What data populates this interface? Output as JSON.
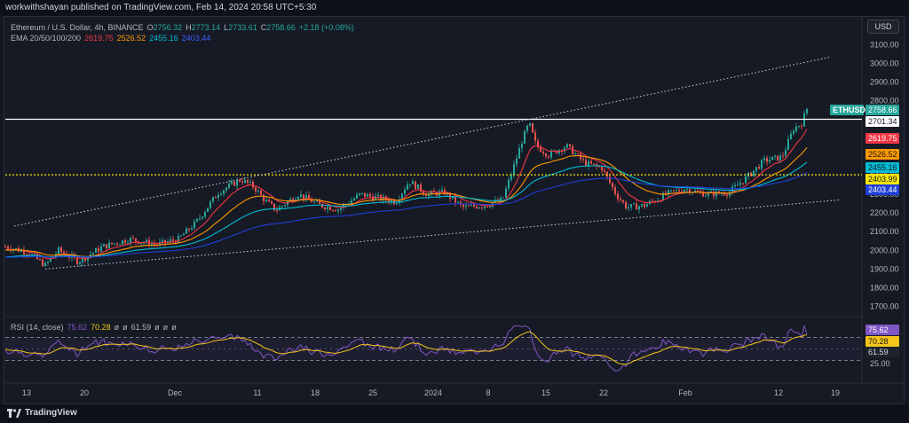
{
  "publisher_line": "workwithshayan published on TradingView.com, Feb 14, 2024 20:58 UTC+5:30",
  "legend": {
    "symbol": "Ethereum / U.S. Dollar, 4h, BINANCE",
    "ohlc": [
      {
        "label": "O",
        "value": "2756.32"
      },
      {
        "label": "H",
        "value": "2773.14"
      },
      {
        "label": "L",
        "value": "2733.61"
      },
      {
        "label": "C",
        "value": "2758.66"
      }
    ],
    "change": "+2.18 (+0.08%)",
    "ema": {
      "label": "EMA 20/50/100/200",
      "values": [
        {
          "value": "2619.75",
          "color": "#f23645"
        },
        {
          "value": "2526.52",
          "color": "#ff9800"
        },
        {
          "value": "2455.16",
          "color": "#00bcd4"
        },
        {
          "value": "2403.44",
          "color": "#1e3fd8"
        }
      ]
    }
  },
  "rsi_legend": {
    "label": "RSI (14, close)",
    "v1": "75.62",
    "v2": "70.28",
    "v3": "61.59",
    "empty": "ø"
  },
  "currency": "USD",
  "price_axis": [
    "3100.00",
    "3000.00",
    "2900.00",
    "2800.00",
    "2700.00",
    "2600.00",
    "2500.00",
    "2400.00",
    "2300.00",
    "2200.00",
    "2100.00",
    "2000.00",
    "1900.00",
    "1800.00",
    "1700.00"
  ],
  "rsi_axis": [
    "80.23",
    "25.00"
  ],
  "price_tags": [
    {
      "id": "ethusd-tag",
      "symbol": "ETHUSD",
      "value": "2758.66",
      "bg": "#26a69a",
      "fg": "#ffffff"
    },
    {
      "id": "level-2701-tag",
      "value": "2701.34",
      "bg": "#ffffff",
      "fg": "#131722"
    },
    {
      "id": "ema20-tag",
      "value": "2619.75",
      "bg": "#f23645",
      "fg": "#ffffff"
    },
    {
      "id": "ema50-tag",
      "value": "2526.52",
      "bg": "#ff9800",
      "fg": "#131722"
    },
    {
      "id": "ema100-tag",
      "value": "2455.16",
      "bg": "#00bcd4",
      "fg": "#131722"
    },
    {
      "id": "level-2403-tag",
      "value": "2403.99",
      "bg": "#f5e50a",
      "fg": "#131722"
    },
    {
      "id": "ema200-tag",
      "value": "2403.44",
      "bg": "#1e3fd8",
      "fg": "#ffffff"
    }
  ],
  "rsi_tags": [
    {
      "id": "rsi-tag",
      "value": "75.62",
      "bg": "#7e57c2",
      "fg": "#ffffff"
    },
    {
      "id": "rsi-ma-tag",
      "value": "70.28",
      "bg": "#f5c518",
      "fg": "#131722"
    },
    {
      "id": "rsi-3-tag",
      "value": "61.59",
      "bg": "#1e222d",
      "fg": "#d1d4dc"
    }
  ],
  "time_axis": [
    "13",
    "20",
    "Dec",
    "11",
    "18",
    "25",
    "2024",
    "8",
    "15",
    "22",
    "Feb",
    "12",
    "19"
  ],
  "footer_brand": "TradingView",
  "colors": {
    "up": "#26a69a",
    "down": "#ef5350",
    "rsi": "#7e57c2",
    "rsi_ma": "#f5c518"
  },
  "chart_data": {
    "type": "candlestick",
    "symbol": "ETHUSD",
    "timeframe": "4h",
    "ylim": [
      1650,
      3150
    ],
    "waypoints": [
      {
        "t": 0,
        "p": 2020
      },
      {
        "t": 25,
        "p": 1990
      },
      {
        "t": 45,
        "p": 1920
      },
      {
        "t": 60,
        "p": 2000
      },
      {
        "t": 82,
        "p": 1940
      },
      {
        "t": 110,
        "p": 2020
      },
      {
        "t": 140,
        "p": 2060
      },
      {
        "t": 170,
        "p": 2030
      },
      {
        "t": 195,
        "p": 2060
      },
      {
        "t": 215,
        "p": 2150
      },
      {
        "t": 240,
        "p": 2310
      },
      {
        "t": 265,
        "p": 2380
      },
      {
        "t": 280,
        "p": 2340
      },
      {
        "t": 292,
        "p": 2270
      },
      {
        "t": 305,
        "p": 2215
      },
      {
        "t": 330,
        "p": 2300
      },
      {
        "t": 355,
        "p": 2240
      },
      {
        "t": 375,
        "p": 2220
      },
      {
        "t": 400,
        "p": 2300
      },
      {
        "t": 420,
        "p": 2280
      },
      {
        "t": 440,
        "p": 2260
      },
      {
        "t": 455,
        "p": 2370
      },
      {
        "t": 475,
        "p": 2300
      },
      {
        "t": 495,
        "p": 2310
      },
      {
        "t": 515,
        "p": 2230
      },
      {
        "t": 540,
        "p": 2240
      },
      {
        "t": 560,
        "p": 2270
      },
      {
        "t": 575,
        "p": 2480
      },
      {
        "t": 583,
        "p": 2600
      },
      {
        "t": 590,
        "p": 2680
      },
      {
        "t": 598,
        "p": 2560
      },
      {
        "t": 612,
        "p": 2510
      },
      {
        "t": 632,
        "p": 2560
      },
      {
        "t": 652,
        "p": 2470
      },
      {
        "t": 672,
        "p": 2440
      },
      {
        "t": 688,
        "p": 2300
      },
      {
        "t": 700,
        "p": 2230
      },
      {
        "t": 720,
        "p": 2240
      },
      {
        "t": 745,
        "p": 2300
      },
      {
        "t": 765,
        "p": 2330
      },
      {
        "t": 790,
        "p": 2300
      },
      {
        "t": 815,
        "p": 2310
      },
      {
        "t": 835,
        "p": 2390
      },
      {
        "t": 855,
        "p": 2480
      },
      {
        "t": 875,
        "p": 2500
      },
      {
        "t": 888,
        "p": 2650
      },
      {
        "t": 897,
        "p": 2680
      },
      {
        "t": 903,
        "p": 2758
      }
    ],
    "horizontal_levels": [
      2701.34,
      2403.99
    ],
    "trendlines": [
      {
        "from": [
          10,
          2130
        ],
        "to": [
          930,
          3035
        ],
        "style": "dotted"
      },
      {
        "from": [
          45,
          1900
        ],
        "to": [
          940,
          2270
        ],
        "style": "dotted"
      }
    ],
    "rsi": {
      "range": [
        0,
        100
      ],
      "bands": [
        70,
        30
      ]
    }
  }
}
